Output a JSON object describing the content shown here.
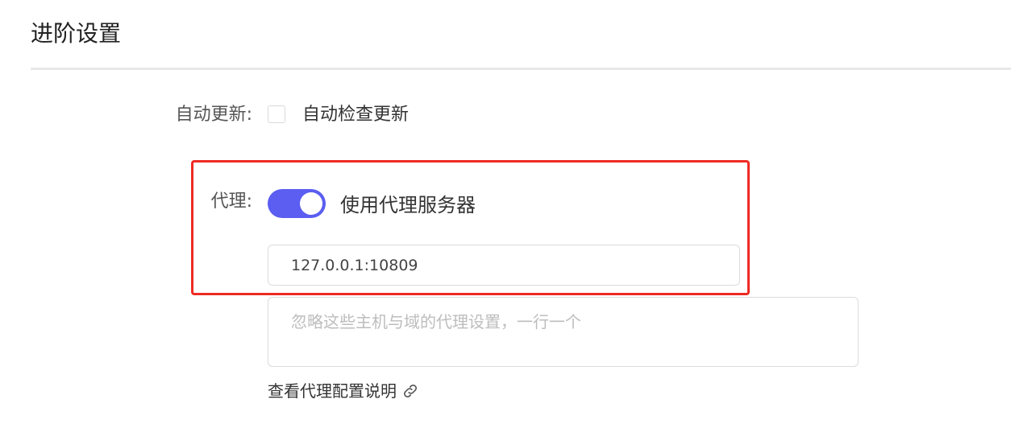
{
  "section": {
    "title": "进阶设置"
  },
  "auto_update": {
    "label": "自动更新:",
    "checkbox_label": "自动检查更新",
    "checked": false
  },
  "proxy": {
    "label": "代理:",
    "toggle_label": "使用代理服务器",
    "enabled": true,
    "server_value": "127.0.0.1:10809",
    "bypass_placeholder": "忽略这些主机与域的代理设置，一行一个",
    "docs_link_label": "查看代理配置说明",
    "docs_link_icon": "link-icon"
  },
  "colors": {
    "accent": "#5b5ef0",
    "highlight_border": "#ee2b24"
  }
}
